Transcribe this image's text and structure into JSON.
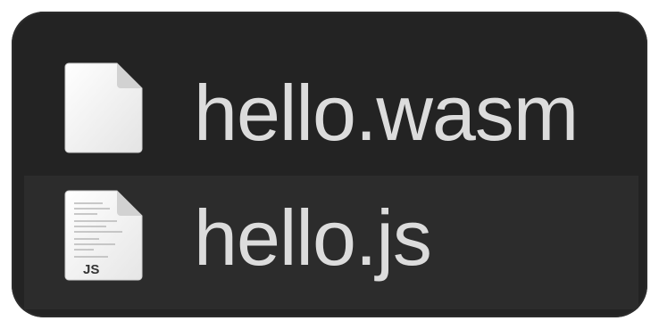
{
  "files": [
    {
      "name": "hello.wasm",
      "icon": "blank-document-icon",
      "selected": false
    },
    {
      "name": "hello.js",
      "icon": "javascript-document-icon",
      "badge": "JS",
      "selected": true
    }
  ],
  "colors": {
    "panel_bg": "#232323",
    "selected_row_bg": "#2c2c2c",
    "text": "#dcdcdc"
  }
}
